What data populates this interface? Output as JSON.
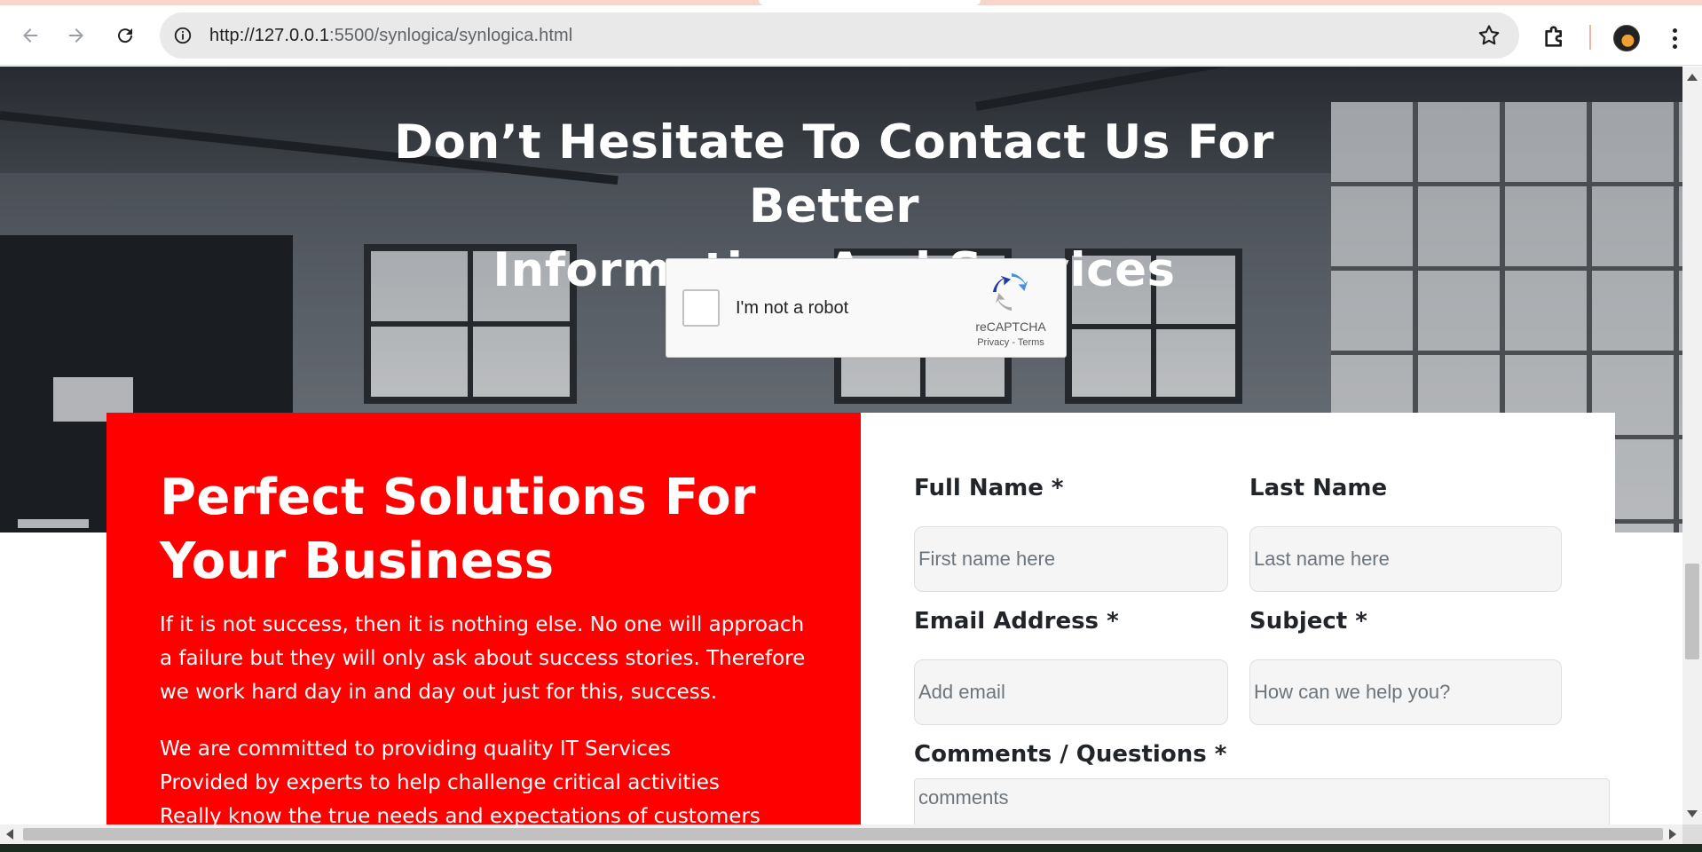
{
  "browser": {
    "url_host": "http://127.0.0.1",
    "url_rest": ":5500/synlogica/synlogica.html",
    "icons": {
      "back": "arrow-left-icon",
      "forward": "arrow-right-icon",
      "reload": "reload-icon",
      "site_info": "info-icon",
      "bookmark": "star-icon",
      "extensions": "puzzle-icon",
      "profile": "avatar",
      "menu": "kebab-menu-icon"
    }
  },
  "hero": {
    "title_line1": "Don’t Hesitate To Contact Us For Better",
    "title_line2": "Information And Services"
  },
  "recaptcha": {
    "label": "I'm not a robot",
    "brand": "reCAPTCHA",
    "privacy": "Privacy",
    "separator": " - ",
    "terms": "Terms"
  },
  "solutions": {
    "heading": "Perfect Solutions For Your Business",
    "paragraph": "If it is not success, then it is nothing else. No one will approach a failure but they will only ask about success stories. Therefore we work hard day in and day out just for this, success.",
    "list": [
      "We are committed to providing quality IT Services",
      "Provided by experts to help challenge critical activities",
      "Really know the true needs and expectations of customers"
    ],
    "accent_color": "#ff0000"
  },
  "form": {
    "full_name_label": "Full Name *",
    "full_name_placeholder": "First name here",
    "last_name_label": "Last Name",
    "last_name_placeholder": "Last name here",
    "email_label": "Email Address *",
    "email_placeholder": "Add email",
    "subject_label": "Subject *",
    "subject_placeholder": "How can we help you?",
    "comments_label": "Comments / Questions *",
    "comments_placeholder": "comments"
  }
}
